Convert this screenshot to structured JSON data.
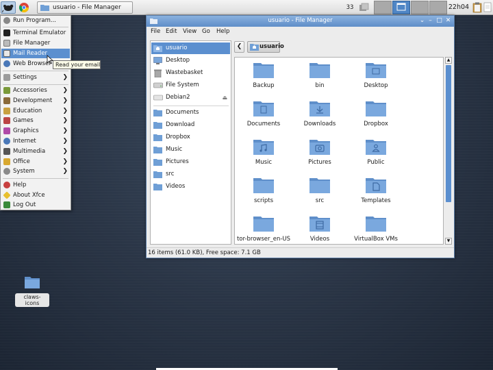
{
  "panel": {
    "task_title": "usuario - File Manager",
    "badge": "33",
    "clock": "22h04"
  },
  "menu": {
    "items": [
      {
        "label": "Run Program..."
      },
      {
        "label": "Terminal Emulator"
      },
      {
        "label": "File Manager"
      },
      {
        "label": "Mail Reader"
      },
      {
        "label": "Web Browser"
      },
      {
        "label": "Settings"
      },
      {
        "label": "Accessories"
      },
      {
        "label": "Development"
      },
      {
        "label": "Education"
      },
      {
        "label": "Games"
      },
      {
        "label": "Graphics"
      },
      {
        "label": "Internet"
      },
      {
        "label": "Multimedia"
      },
      {
        "label": "Office"
      },
      {
        "label": "System"
      },
      {
        "label": "Help"
      },
      {
        "label": "About Xfce"
      },
      {
        "label": "Log Out"
      }
    ],
    "tooltip": "Read your email"
  },
  "window": {
    "title": "usuario - File Manager",
    "menubar": [
      "File",
      "Edit",
      "View",
      "Go",
      "Help"
    ],
    "side_items": [
      {
        "label": "usuario"
      },
      {
        "label": "Desktop"
      },
      {
        "label": "Wastebasket"
      },
      {
        "label": "File System"
      },
      {
        "label": "Debian2"
      },
      {
        "label": "Documents"
      },
      {
        "label": "Download"
      },
      {
        "label": "Dropbox"
      },
      {
        "label": "Music"
      },
      {
        "label": "Pictures"
      },
      {
        "label": "src"
      },
      {
        "label": "Videos"
      }
    ],
    "path": "usuario",
    "files": [
      {
        "label": "Backup"
      },
      {
        "label": "bin"
      },
      {
        "label": "Desktop"
      },
      {
        "label": "Documents"
      },
      {
        "label": "Downloads"
      },
      {
        "label": "Dropbox"
      },
      {
        "label": "Music"
      },
      {
        "label": "Pictures"
      },
      {
        "label": "Public"
      },
      {
        "label": "scripts"
      },
      {
        "label": "src"
      },
      {
        "label": "Templates"
      },
      {
        "label": "tor-browser_en-US"
      },
      {
        "label": "Videos"
      },
      {
        "label": "VirtualBox VMs"
      }
    ],
    "status": "16 items (61.0 KB), Free space: 7.1 GB"
  },
  "desktop": {
    "icon_label": "claws-icons"
  },
  "colors": {
    "accent": "#5b8fcf",
    "folder": "#6f9fd6",
    "desktop_bg": "#2a3546"
  }
}
